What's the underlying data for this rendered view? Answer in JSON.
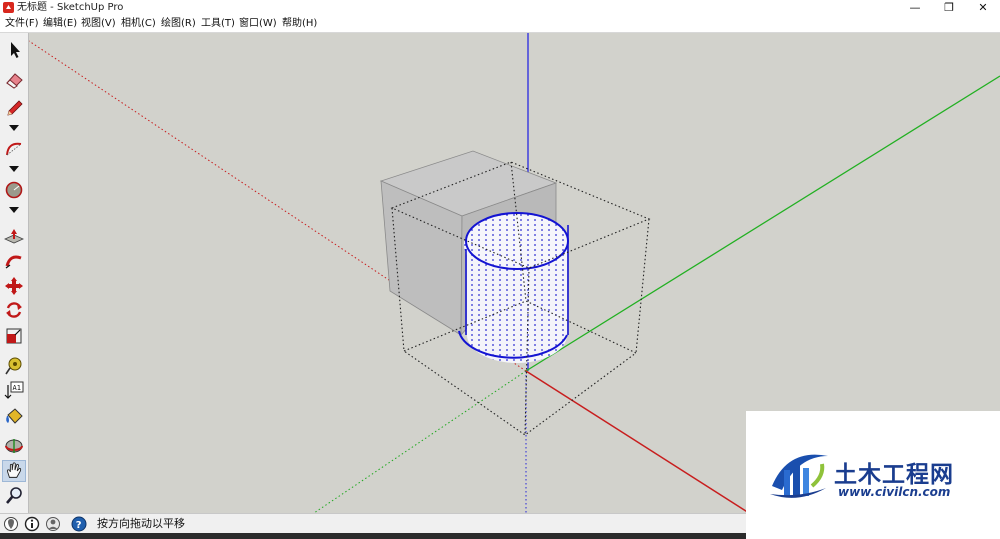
{
  "window": {
    "title": "无标题 - SketchUp Pro",
    "minimize_glyph": "—",
    "restore_glyph": "❐",
    "close_glyph": "✕"
  },
  "menu": {
    "items": [
      "文件(F)",
      "编辑(E)",
      "视图(V)",
      "相机(C)",
      "绘图(R)",
      "工具(T)",
      "窗口(W)",
      "帮助(H)"
    ]
  },
  "toolbar": {
    "tools": [
      {
        "name": "select-tool",
        "icon": "arrow-cursor-icon"
      },
      {
        "name": "eraser-tool",
        "icon": "eraser-icon"
      },
      {
        "name": "pencil-tool",
        "icon": "pencil-icon",
        "has_dropdown": true
      },
      {
        "name": "arc-tool",
        "icon": "arc-icon",
        "has_dropdown": true
      },
      {
        "name": "shape-tool",
        "icon": "circle-shape-icon",
        "has_dropdown": true
      },
      {
        "name": "push-pull-tool",
        "icon": "push-pull-icon"
      },
      {
        "name": "follow-me-tool",
        "icon": "follow-me-icon"
      },
      {
        "name": "move-tool",
        "icon": "move-icon"
      },
      {
        "name": "rotate-tool",
        "icon": "rotate-icon"
      },
      {
        "name": "scale-tool",
        "icon": "scale-icon"
      },
      {
        "name": "tape-measure-tool",
        "icon": "tape-measure-icon"
      },
      {
        "name": "text-tool",
        "icon": "text-label-icon",
        "label": "A1"
      },
      {
        "name": "paint-bucket-tool",
        "icon": "paint-bucket-icon"
      },
      {
        "name": "orbit-tool",
        "icon": "orbit-icon"
      },
      {
        "name": "pan-tool",
        "icon": "hand-pan-icon",
        "active": true
      },
      {
        "name": "zoom-tool",
        "icon": "magnifier-icon"
      }
    ]
  },
  "status": {
    "text": "按方向拖动以平移",
    "icons": [
      "geo-location-icon",
      "info-icon",
      "user-icon",
      "help-icon"
    ]
  },
  "watermark": {
    "name": "土木工程网",
    "url": "www.civilcn.com"
  },
  "colors": {
    "viewport_bg": "#d2d2cc",
    "axis_red": "#c81e1e",
    "axis_green": "#1fb01f",
    "axis_blue": "#2424d8",
    "selection_blue": "#1414d2",
    "box_face": "#c6c6c6",
    "watermark_blue": "#1a3d8f"
  }
}
